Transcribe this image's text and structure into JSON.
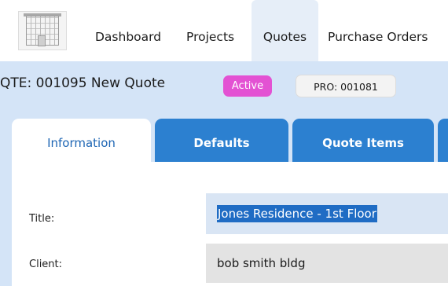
{
  "nav": {
    "items": [
      {
        "label": "Dashboard"
      },
      {
        "label": "Projects"
      },
      {
        "label": "Quotes"
      },
      {
        "label": "Purchase Orders"
      }
    ],
    "active": "Quotes"
  },
  "header": {
    "title": "QTE: 001095 New Quote",
    "status_badge": "Active",
    "project_ref": "PRO: 001081"
  },
  "tabs": [
    {
      "label": "Information",
      "selected": true
    },
    {
      "label": "Defaults",
      "selected": false
    },
    {
      "label": "Quote Items",
      "selected": false
    },
    {
      "label": "",
      "selected": false
    }
  ],
  "form": {
    "title": {
      "label": "Title:",
      "value": "Jones Residence - 1st Floor"
    },
    "client": {
      "label": "Client:",
      "value": "bob smith bldg"
    }
  },
  "colors": {
    "header_band": "#d4e4f7",
    "active_badge": "#e352d3",
    "tab_blue": "#2c80d0",
    "selected_tab_text": "#1e66b4",
    "text_selection": "#1f6cc4"
  }
}
